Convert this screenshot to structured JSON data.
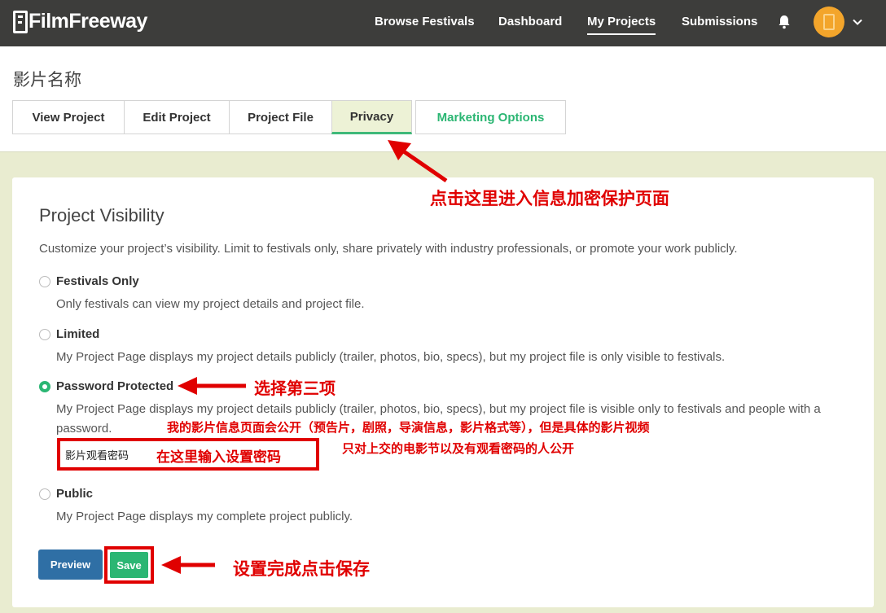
{
  "topbar": {
    "brand": "FilmFreeway",
    "nav": [
      "Browse Festivals",
      "Dashboard",
      "My Projects",
      "Submissions"
    ],
    "active_nav": "My Projects",
    "icons": [
      "bell-icon",
      "avatar",
      "chevron-down-icon"
    ]
  },
  "page": {
    "title": "影片名称",
    "tabs": [
      "View Project",
      "Edit Project",
      "Project File",
      "Privacy",
      "Marketing Options"
    ],
    "active_tab": "Privacy"
  },
  "visibility": {
    "title": "Project Visibility",
    "description": "Customize your project’s visibility. Limit to festivals only, share privately with industry professionals, or promote your work publicly.",
    "options": [
      {
        "label": "Festivals Only",
        "desc": "Only festivals can view my project details and project file.",
        "checked": false
      },
      {
        "label": "Limited",
        "desc": "My Project Page displays my project details publicly (trailer, photos, bio, specs), but my project file is only visible to festivals.",
        "checked": false
      },
      {
        "label": "Password Protected",
        "desc": "My Project Page displays my project details publicly (trailer, photos, bio, specs), but my project file is visible only to festivals and people with a password.",
        "checked": true
      },
      {
        "label": "Public",
        "desc": "My Project Page displays my complete project publicly.",
        "checked": false
      }
    ],
    "password_value": "影片观看密码"
  },
  "buttons": {
    "preview": "Preview",
    "save": "Save"
  },
  "annotations": {
    "privacy_tab": "点击这里进入信息加密保护页面",
    "select_third": "选择第三项",
    "explain_line1": "我的影片信息页面会公开（预告片，剧照，导演信息，影片格式等），但是具体的影片视频",
    "explain_line2": "只对上交的电影节以及有观看密码的人公开",
    "enter_password": "在这里输入设置密码",
    "save_hint": "设置完成点击保存"
  },
  "colors": {
    "topbar": "#3d3d3b",
    "accent_green": "#2bb673",
    "preview_blue": "#2f6fa5",
    "annotation_red": "#e00000",
    "page_bg": "#e9ecd0"
  }
}
